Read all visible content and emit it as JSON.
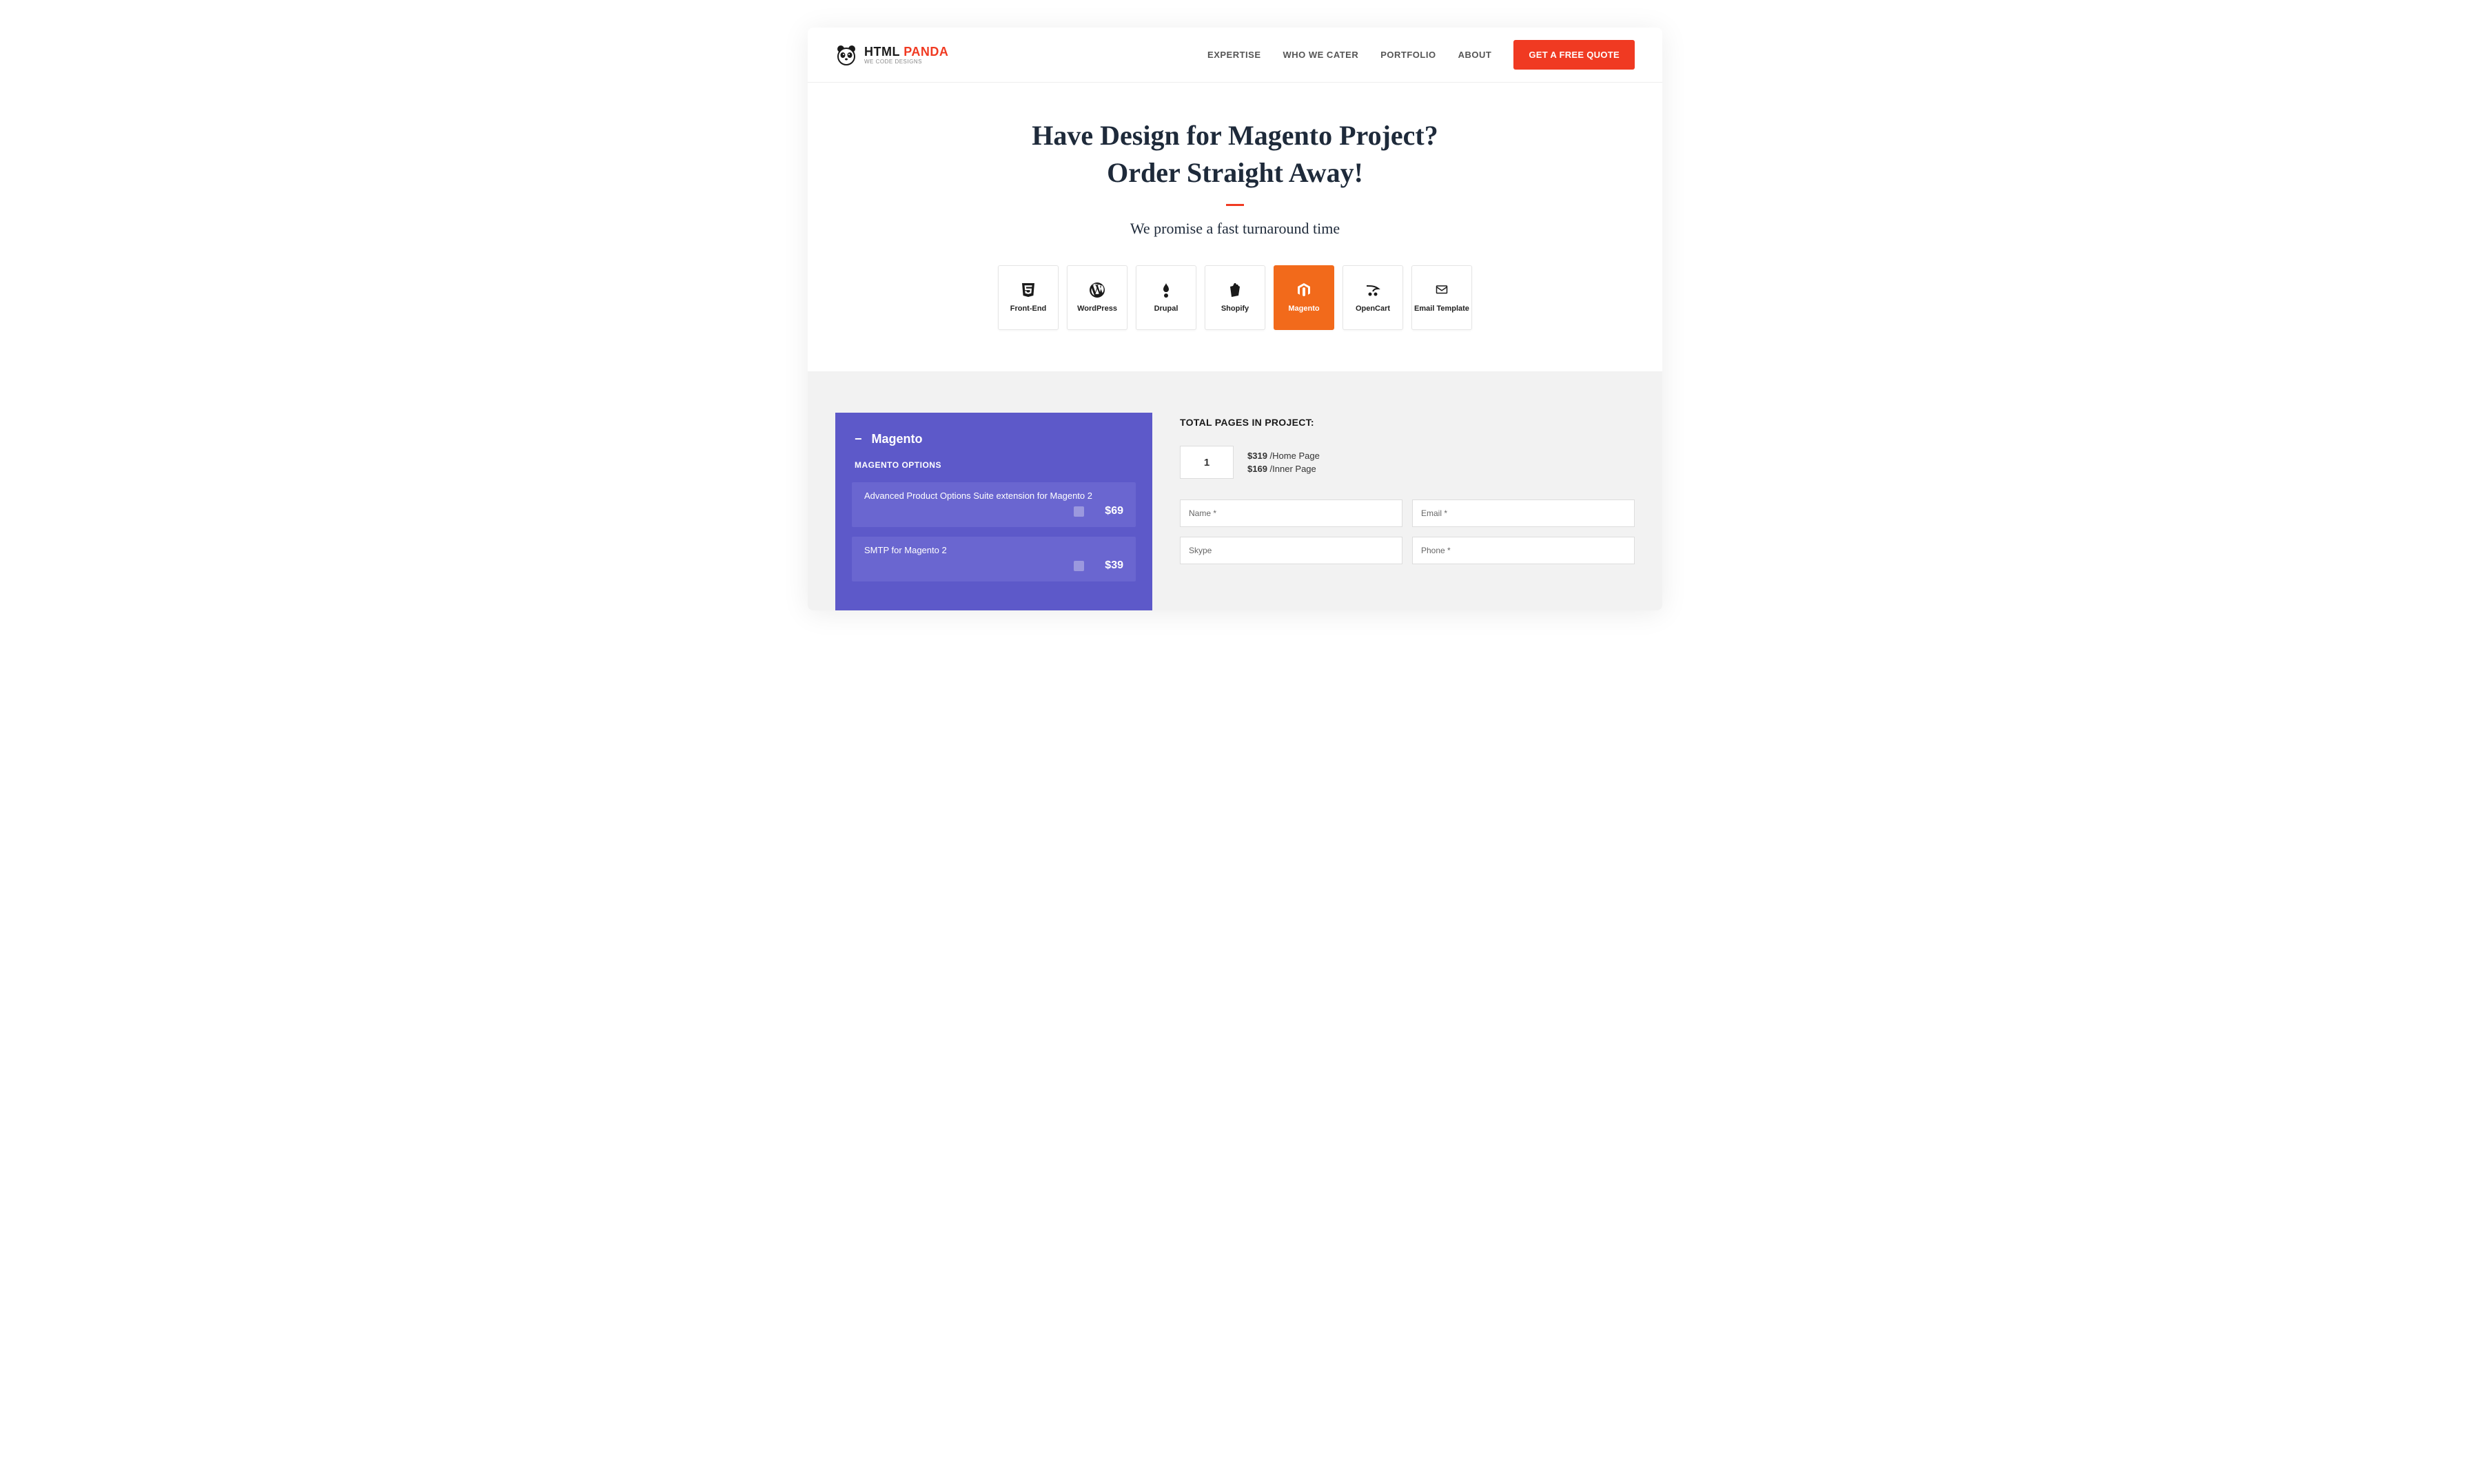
{
  "logo": {
    "html": "HTML",
    "panda": "PANDA",
    "tagline": "WE CODE DESIGNS"
  },
  "nav": {
    "items": [
      "EXPERTISE",
      "WHO WE CATER",
      "PORTFOLIO",
      "ABOUT"
    ],
    "cta": "GET A FREE QUOTE"
  },
  "hero": {
    "title_l1": "Have Design for Magento Project?",
    "title_l2": "Order Straight Away!",
    "subtitle": "We promise a fast turnaround time"
  },
  "tabs": [
    {
      "label": "Front-End"
    },
    {
      "label": "WordPress"
    },
    {
      "label": "Drupal"
    },
    {
      "label": "Shopify"
    },
    {
      "label": "Magento"
    },
    {
      "label": "OpenCart"
    },
    {
      "label": "Email Template"
    }
  ],
  "activeTab": 4,
  "panel": {
    "title": "Magento",
    "optionsLabel": "MAGENTO OPTIONS",
    "options": [
      {
        "name": "Advanced Product Options Suite extension for Magento 2",
        "price": "$69"
      },
      {
        "name": "SMTP for Magento 2",
        "price": "$39"
      }
    ]
  },
  "project": {
    "totalLabel": "TOTAL PAGES IN PROJECT:",
    "pages": "1",
    "homePrice": "$319",
    "homeLabel": "/Home Page",
    "innerPrice": "$169",
    "innerLabel": "/Inner Page"
  },
  "form": {
    "name": "Name *",
    "email": "Email *",
    "skype": "Skype",
    "phone": "Phone *"
  }
}
